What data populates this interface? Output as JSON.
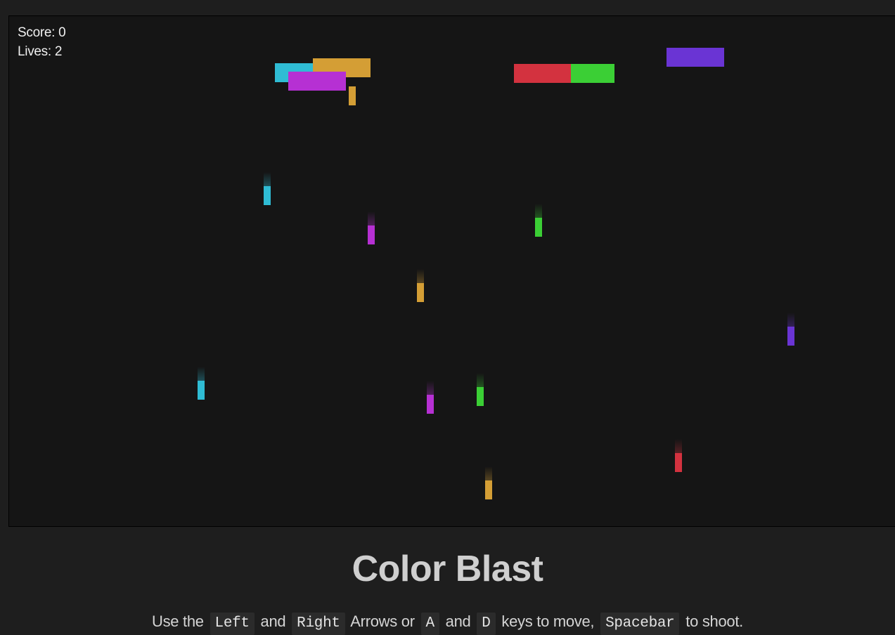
{
  "hud": {
    "score_label": "Score: 0",
    "lives_label": "Lives: 2"
  },
  "game": {
    "colors": {
      "cyan": "#2fbcd4",
      "orange": "#d49e35",
      "magenta": "#b630d3",
      "red": "#d3323f",
      "green": "#3bcf35",
      "purple": "#6a34d4",
      "canvas_bg": "#151515",
      "page_bg": "#1e1e1e"
    }
  },
  "title": "Color Blast",
  "instructions": {
    "part1": "Use the",
    "key_left": "Left",
    "and1": "and",
    "key_right": "Right",
    "part2": "Arrows or",
    "key_a": "A",
    "and2": "and",
    "key_d": "D",
    "part3": "keys to move,",
    "key_space": "Spacebar",
    "part4": "to shoot."
  }
}
